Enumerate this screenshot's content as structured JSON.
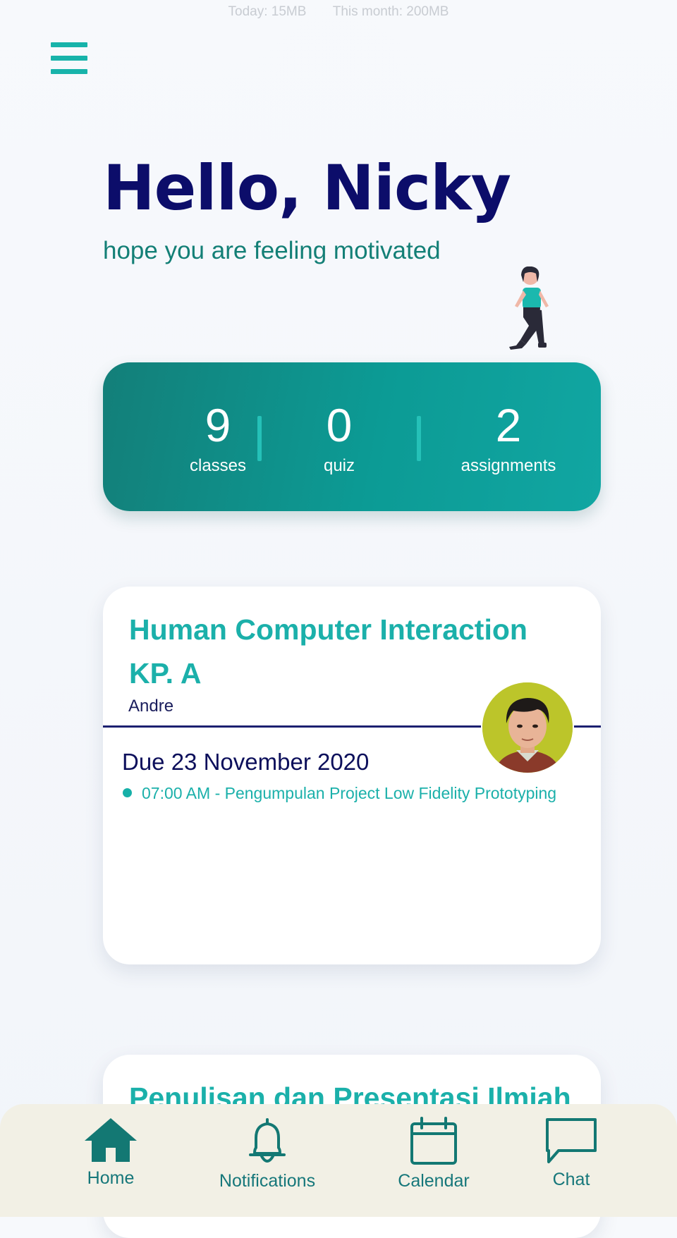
{
  "status": {
    "today": "Today: 15MB",
    "month": "This month: 200MB"
  },
  "greeting": {
    "title": "Hello, Nicky",
    "subtitle": "hope you are feeling motivated"
  },
  "stats": [
    {
      "value": "9",
      "label": "classes"
    },
    {
      "value": "0",
      "label": "quiz"
    },
    {
      "value": "2",
      "label": "assignments"
    }
  ],
  "courses": [
    {
      "title": "Human Computer Interaction KP. A",
      "lecturer": "Andre",
      "due": "Due 23 November 2020",
      "task": "07:00 AM - Pengumpulan Project Low Fidelity Prototyping"
    },
    {
      "title": "Penulisan dan Presentasi Ilmiah"
    }
  ],
  "nav": {
    "home": "Home",
    "notifications": "Notifications",
    "calendar": "Calendar",
    "chat": "Chat"
  },
  "colors": {
    "accent": "#17b3aa",
    "dark_navy": "#0c0d6a",
    "card_teal": "#0c9b95",
    "nav_bg": "#f2f0e5"
  },
  "icons": [
    "menu-icon",
    "home-icon",
    "bell-icon",
    "calendar-icon",
    "chat-icon"
  ]
}
